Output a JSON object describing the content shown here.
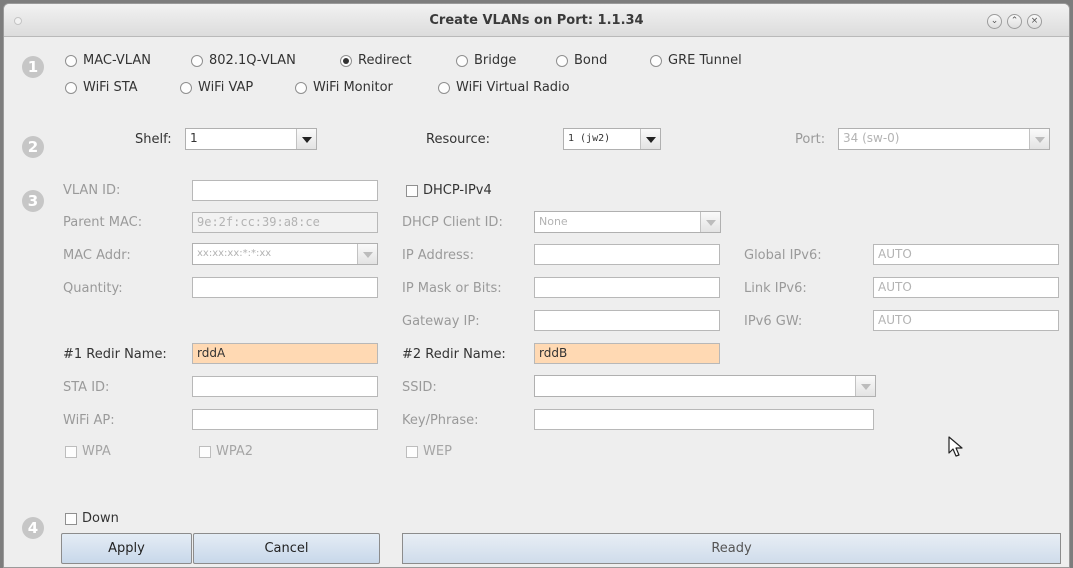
{
  "window": {
    "title": "Create VLANs on Port: 1.1.34",
    "controls": [
      "minimize-icon",
      "maximize-icon",
      "close-icon"
    ]
  },
  "steps": [
    "1",
    "2",
    "3",
    "4"
  ],
  "types": {
    "row1": [
      {
        "label": "MAC-VLAN",
        "selected": false
      },
      {
        "label": "802.1Q-VLAN",
        "selected": false
      },
      {
        "label": "Redirect",
        "selected": true
      },
      {
        "label": "Bridge",
        "selected": false
      },
      {
        "label": "Bond",
        "selected": false
      },
      {
        "label": "GRE Tunnel",
        "selected": false
      }
    ],
    "row2": [
      {
        "label": "WiFi STA",
        "selected": false
      },
      {
        "label": "WiFi VAP",
        "selected": false
      },
      {
        "label": "WiFi Monitor",
        "selected": false
      },
      {
        "label": "WiFi Virtual Radio",
        "selected": false
      }
    ]
  },
  "location": {
    "shelf_label": "Shelf:",
    "shelf_value": "1",
    "resource_label": "Resource:",
    "resource_value": "1 (jw2)",
    "port_label": "Port:",
    "port_value": "34 (sw-0)"
  },
  "form": {
    "vlan_id_label": "VLAN ID:",
    "vlan_id_value": "",
    "parent_mac_label": "Parent MAC:",
    "parent_mac_value": "9e:2f:cc:39:a8:ce",
    "mac_addr_label": "MAC Addr:",
    "mac_addr_value": "xx:xx:xx:*:*:xx",
    "quantity_label": "Quantity:",
    "quantity_value": "",
    "dhcp_label": "DHCP-IPv4",
    "dhcp_client_id_label": "DHCP Client ID:",
    "dhcp_client_id_value": "None",
    "ip_address_label": "IP Address:",
    "ip_mask_label": "IP Mask or Bits:",
    "gateway_label": "Gateway IP:",
    "global_ipv6_label": "Global IPv6:",
    "global_ipv6_value": "AUTO",
    "link_ipv6_label": "Link IPv6:",
    "link_ipv6_value": "AUTO",
    "ipv6_gw_label": "IPv6 GW:",
    "ipv6_gw_value": "AUTO",
    "redir1_label": "#1 Redir Name:",
    "redir1_value": "rddA",
    "redir2_label": "#2 Redir Name:",
    "redir2_value": "rddB",
    "sta_id_label": "STA ID:",
    "ssid_label": "SSID:",
    "wifi_ap_label": "WiFi AP:",
    "key_label": "Key/Phrase:",
    "wpa_label": "WPA",
    "wpa2_label": "WPA2",
    "wep_label": "WEP"
  },
  "footer": {
    "down_label": "Down",
    "apply_label": "Apply",
    "cancel_label": "Cancel",
    "status_text": "Ready"
  },
  "colors": {
    "redir_field_bg": "#ffd9b3",
    "button_bg": "#d6e2ef"
  }
}
